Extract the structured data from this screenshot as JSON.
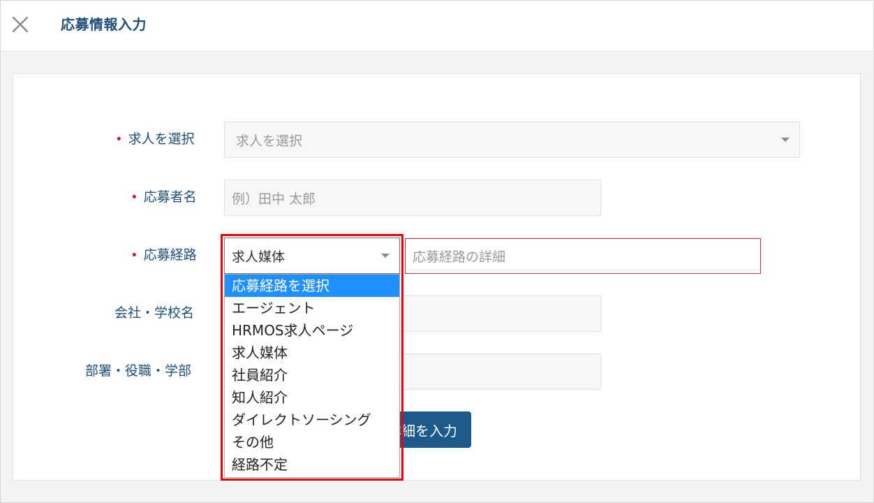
{
  "header": {
    "title": "応募情報入力",
    "close_icon": "close-icon"
  },
  "form": {
    "job": {
      "label": "求人を選択",
      "placeholder": "求人を選択",
      "required": true
    },
    "applicant_name": {
      "label": "応募者名",
      "placeholder": "例）田中 太郎",
      "required": true
    },
    "route": {
      "label": "応募経路",
      "selected": "求人媒体",
      "detail_placeholder": "応募経路の詳細",
      "required": true,
      "options": [
        "応募経路を選択",
        "エージェント",
        "HRMOS求人ページ",
        "求人媒体",
        "社員紹介",
        "知人紹介",
        "ダイレクトソーシング",
        "その他",
        "経路不定"
      ],
      "highlighted_option": "応募経路を選択"
    },
    "company": {
      "label": "会社・学校名"
    },
    "department": {
      "label": "部署・役職・学部"
    },
    "submit_partial_label": "詳細を入力"
  },
  "colors": {
    "accent": "#1f4e79",
    "required_dot": "#c0282d",
    "selected_option": "#1e90ff",
    "highlight_box": "#e8000b",
    "button": "#1d5a8c"
  }
}
